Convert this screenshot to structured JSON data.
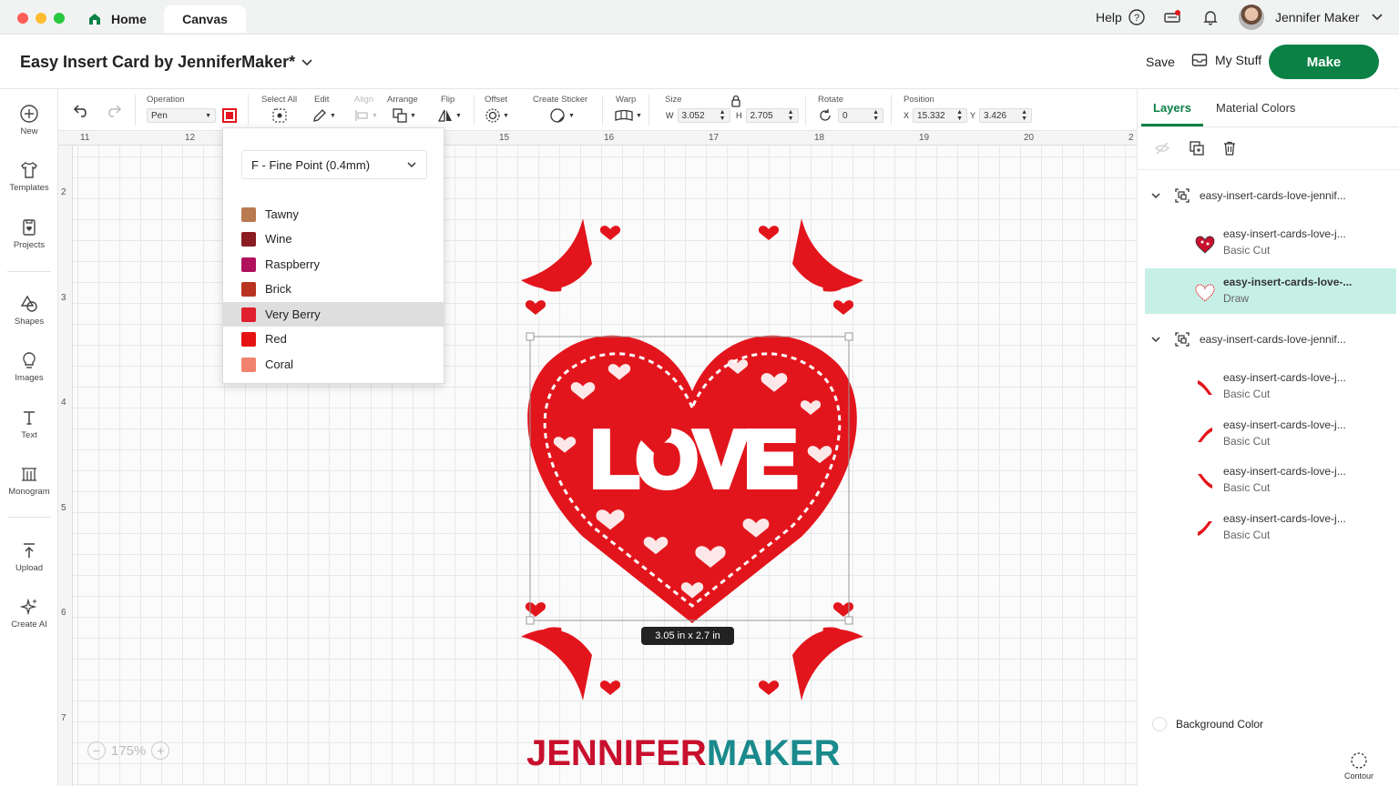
{
  "tabs": {
    "home": "Home",
    "canvas": "Canvas"
  },
  "topbar": {
    "help": "Help",
    "user_name": "Jennifer Maker"
  },
  "project": {
    "title": "Easy Insert Card by JenniferMaker*",
    "save": "Save",
    "my_stuff": "My Stuff",
    "make": "Make"
  },
  "sidebar": {
    "items": [
      {
        "label": "New",
        "icon": "plus-circle-icon"
      },
      {
        "label": "Templates",
        "icon": "shirt-icon"
      },
      {
        "label": "Projects",
        "icon": "projects-icon"
      },
      {
        "label": "Shapes",
        "icon": "shapes-icon"
      },
      {
        "label": "Images",
        "icon": "lightbulb-icon"
      },
      {
        "label": "Text",
        "icon": "text-icon"
      },
      {
        "label": "Monogram",
        "icon": "monogram-icon"
      },
      {
        "label": "Upload",
        "icon": "upload-icon"
      },
      {
        "label": "Create AI",
        "icon": "sparkle-icon"
      }
    ]
  },
  "toolbar": {
    "operation_label": "Operation",
    "operation_value": "Pen",
    "select_all": "Select All",
    "edit": "Edit",
    "align": "Align",
    "arrange": "Arrange",
    "flip": "Flip",
    "offset": "Offset",
    "create_sticker": "Create Sticker",
    "warp": "Warp",
    "size": "Size",
    "w_label": "W",
    "w_value": "3.052",
    "h_label": "H",
    "h_value": "2.705",
    "rotate": "Rotate",
    "rotate_value": "0",
    "position": "Position",
    "x_label": "X",
    "x_value": "15.332",
    "y_label": "Y",
    "y_value": "3.426"
  },
  "ruler": {
    "top": [
      "11",
      "12",
      "15",
      "16",
      "17",
      "18",
      "19",
      "20",
      "2"
    ],
    "left": [
      "2",
      "3",
      "4",
      "5",
      "6",
      "7"
    ]
  },
  "pen_dropdown": {
    "pen_type": "F - Fine Point (0.4mm)",
    "colors": [
      {
        "name": "Tawny",
        "color": "#b97a4f"
      },
      {
        "name": "Wine",
        "color": "#8b1c22"
      },
      {
        "name": "Raspberry",
        "color": "#b0125e"
      },
      {
        "name": "Brick",
        "color": "#b93320"
      },
      {
        "name": "Very Berry",
        "color": "#e0202f"
      },
      {
        "name": "Red",
        "color": "#e61212"
      },
      {
        "name": "Coral",
        "color": "#f0826e"
      }
    ],
    "selected": "Very Berry"
  },
  "canvas": {
    "size_readout": "3.05  in x 2.7  in",
    "zoom": "175%",
    "heart_text": "LOVE",
    "brand_part1": "JENNIFER",
    "brand_part2": "MAKER",
    "accent": "#e3151c"
  },
  "panel": {
    "tab_layers": "Layers",
    "tab_material": "Material Colors",
    "groups": [
      {
        "name": "easy-insert-cards-love-jennif...",
        "items": [
          {
            "name": "easy-insert-cards-love-j...",
            "type": "Basic Cut"
          },
          {
            "name": "easy-insert-cards-love-...",
            "type": "Draw"
          }
        ]
      },
      {
        "name": "easy-insert-cards-love-jennif...",
        "items": [
          {
            "name": "easy-insert-cards-love-j...",
            "type": "Basic Cut"
          },
          {
            "name": "easy-insert-cards-love-j...",
            "type": "Basic Cut"
          },
          {
            "name": "easy-insert-cards-love-j...",
            "type": "Basic Cut"
          },
          {
            "name": "easy-insert-cards-love-j...",
            "type": "Basic Cut"
          }
        ]
      }
    ],
    "background_color": "Background Color",
    "contour": "Contour"
  }
}
